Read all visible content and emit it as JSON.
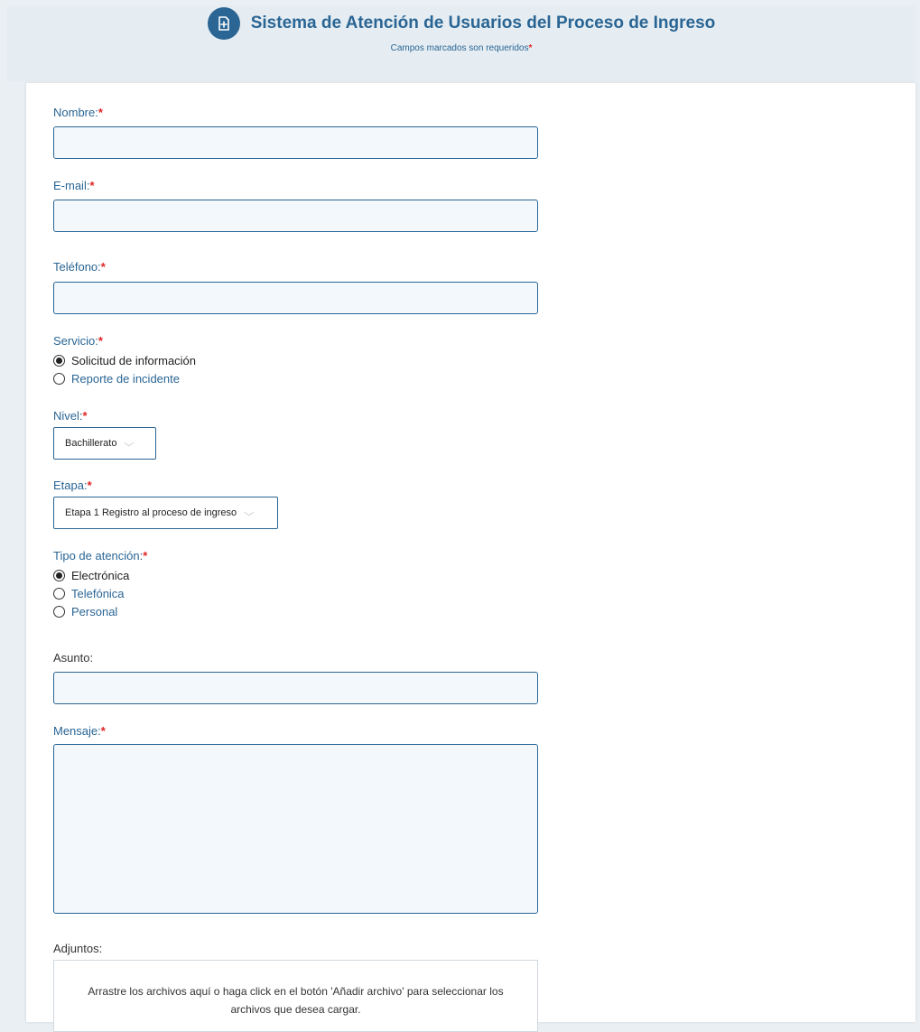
{
  "header": {
    "title": "Sistema de Atención de Usuarios del Proceso de Ingreso",
    "subtitle": "Campos marcados son requeridos",
    "required_mark": "*"
  },
  "form": {
    "nombre": {
      "label": "Nombre:",
      "value": ""
    },
    "email": {
      "label": "E-mail:",
      "value": ""
    },
    "telefono": {
      "label": "Teléfono:",
      "value": ""
    },
    "servicio": {
      "label": "Servicio:",
      "options": [
        "Solicitud de información",
        "Reporte de incidente"
      ],
      "selected": "Solicitud de información"
    },
    "nivel": {
      "label": "Nivel:",
      "selected": "Bachillerato"
    },
    "etapa": {
      "label": "Etapa:",
      "selected": "Etapa 1 Registro al proceso de ingreso"
    },
    "tipo_atencion": {
      "label": "Tipo de atención:",
      "options": [
        "Electrónica",
        "Telefónica",
        "Personal"
      ],
      "selected": "Electrónica"
    },
    "asunto": {
      "label": "Asunto:",
      "value": ""
    },
    "mensaje": {
      "label": "Mensaje:",
      "value": ""
    },
    "adjuntos": {
      "label": "Adjuntos:",
      "dropzone_text": "Arrastre los archivos aquí o haga click en el botón 'Añadir archivo' para seleccionar los archivos que desea cargar."
    }
  },
  "icons": {
    "header_icon": "add-document-icon",
    "select_arrow": "chevron-down-icon"
  },
  "colors": {
    "primary": "#2a6594",
    "required": "#e02424",
    "input_bg": "#f2f8fc",
    "page_bg": "#e9eff3"
  }
}
